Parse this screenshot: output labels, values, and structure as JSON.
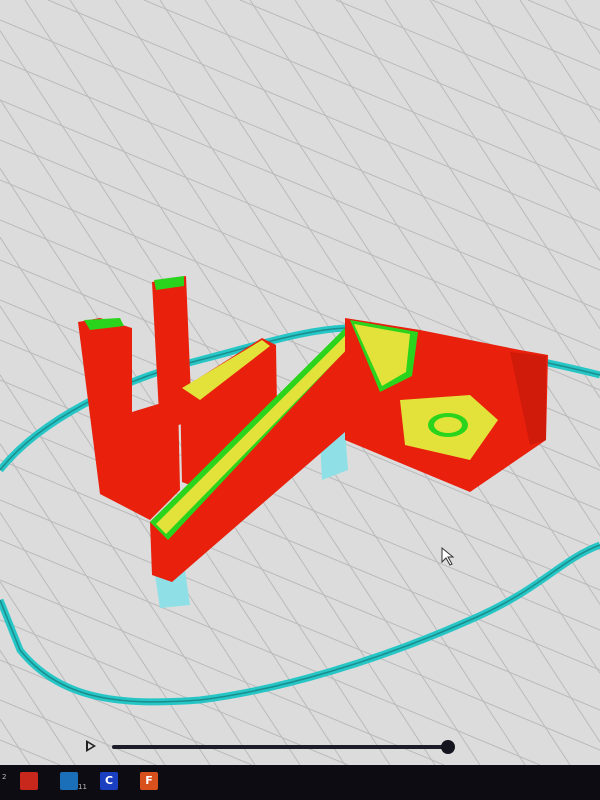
{
  "viewer": {
    "colors": {
      "background": "#dcdcdc",
      "grid": "#b8b9ba",
      "wall": "#e8200c",
      "inner_wall": "#2ad41c",
      "infill": "#e2e23a",
      "skirt": "#27c6c6",
      "support": "#8fe0e6"
    }
  },
  "layer_slider": {
    "play_icon": "play-icon",
    "progress": 1.0
  },
  "taskbar": {
    "items": [
      {
        "icon": "app-icon",
        "badge": "2",
        "color": "#2a6a3a"
      },
      {
        "icon": "office-icon",
        "badge": "",
        "color": "#c8281c"
      },
      {
        "icon": "store-icon",
        "badge": "11",
        "color": "#1a6fb8"
      },
      {
        "icon": "cura-icon",
        "label": "C",
        "badge": "",
        "color": "#1a3fc0"
      },
      {
        "icon": "f-app-icon",
        "label": "F",
        "badge": "",
        "color": "#d8501c"
      }
    ]
  }
}
